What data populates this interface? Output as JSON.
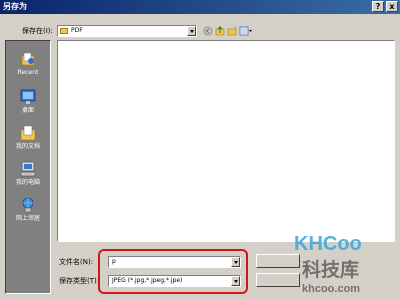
{
  "window": {
    "title": "另存为",
    "help_label": "?",
    "close_label": "x"
  },
  "save_in": {
    "label": "保存在(I):",
    "value": "PDF"
  },
  "places": [
    {
      "label": "Recent",
      "icon": "recent-docs-icon"
    },
    {
      "label": "桌面",
      "icon": "desktop-icon"
    },
    {
      "label": "我的文档",
      "icon": "my-documents-icon"
    },
    {
      "label": "我的电脑",
      "icon": "my-computer-icon"
    },
    {
      "label": "网上邻居",
      "icon": "network-places-icon"
    }
  ],
  "filename": {
    "label": "文件名(N):",
    "value": "p"
  },
  "filetype": {
    "label": "保存类型(T):",
    "value": "JPEG (*.jpg,*.jpeg,*.jpe)"
  },
  "watermark": {
    "logo": "KHCoo",
    "name": "科技库",
    "url": "khcoo.com"
  },
  "colors": {
    "highlight": "#d01818",
    "titlebar": "#0a246a",
    "watermark": "#3aa6d8"
  }
}
